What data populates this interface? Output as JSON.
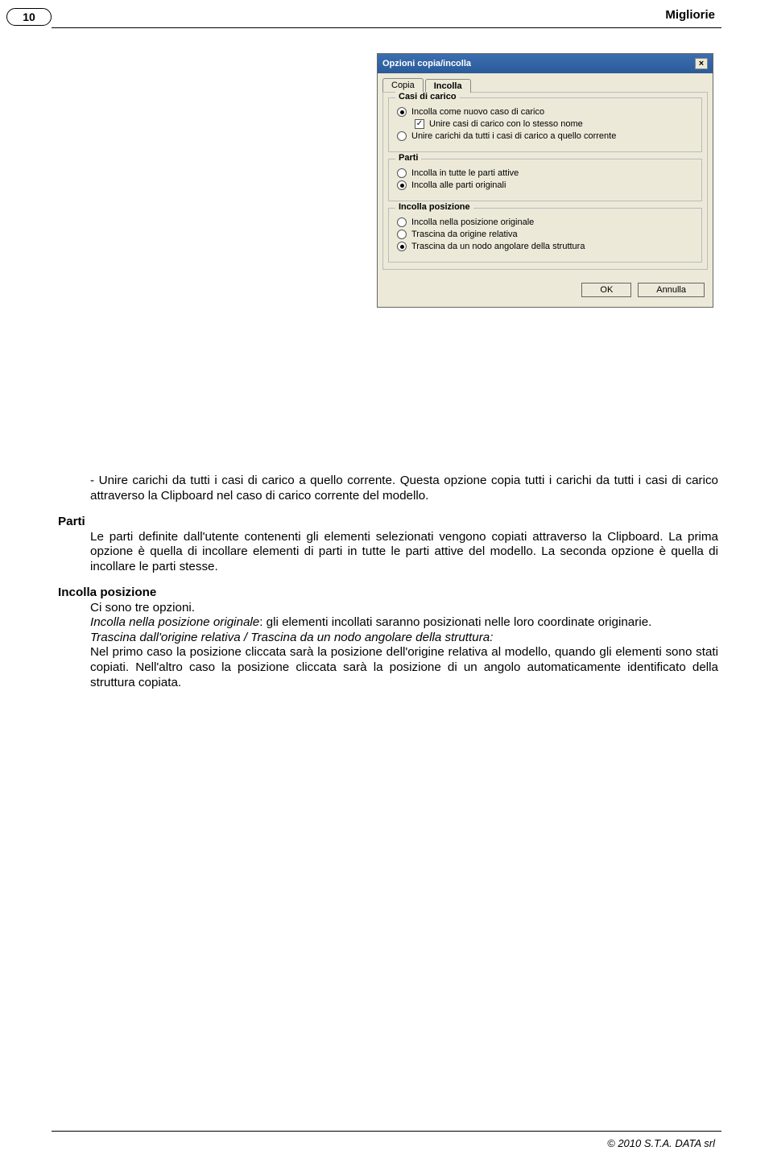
{
  "header": {
    "page_number": "10",
    "title_right": "Migliorie"
  },
  "dialog": {
    "title": "Opzioni copia/incolla",
    "close_label": "×",
    "tabs": {
      "copia": "Copia",
      "incolla": "Incolla"
    },
    "groups": {
      "casi": {
        "title": "Casi di carico",
        "opt1": "Incolla come nuovo caso di carico",
        "opt2": "Unire casi di carico con lo stesso nome",
        "opt3": "Unire carichi da tutti i casi di carico a quello corrente"
      },
      "parti": {
        "title": "Parti",
        "opt1": "Incolla in tutte le parti attive",
        "opt2": "Incolla alle parti originali"
      },
      "posizione": {
        "title": "Incolla posizione",
        "opt1": "Incolla nella posizione originale",
        "opt2": "Trascina da origine relativa",
        "opt3": "Trascina da un nodo angolare della struttura"
      }
    },
    "buttons": {
      "ok": "OK",
      "annulla": "Annulla"
    }
  },
  "text": {
    "para1": "- Unire carichi da tutti i casi di carico a quello corrente. Questa opzione copia tutti i carichi da tutti i casi di carico attraverso la Clipboard nel caso di carico corrente del modello.",
    "h_parti": "Parti",
    "para_parti": "Le parti definite dall'utente contenenti gli elementi selezionati vengono copiati attraverso la Clipboard. La prima opzione è quella di incollare elementi di parti in tutte le parti attive del modello. La seconda opzione è quella di incollare le parti stesse.",
    "h_pos": "Incolla posizione",
    "pos_intro": "Ci sono tre opzioni.",
    "pos_line1_i": "Incolla nella posizione originale",
    "pos_line1_r": ": gli elementi incollati saranno posizionati nelle loro coordinate originarie.",
    "pos_line2": "Trascina dall'origine relativa / Trascina da un nodo angolare della struttura:",
    "pos_line3": "Nel primo caso la posizione cliccata sarà la posizione dell'origine relativa al modello, quando gli elementi sono stati copiati. Nell'altro caso la posizione cliccata sarà la posizione di un angolo automaticamente identificato della struttura copiata."
  },
  "footer": {
    "copyright": "© 2010 S.T.A. DATA srl"
  }
}
